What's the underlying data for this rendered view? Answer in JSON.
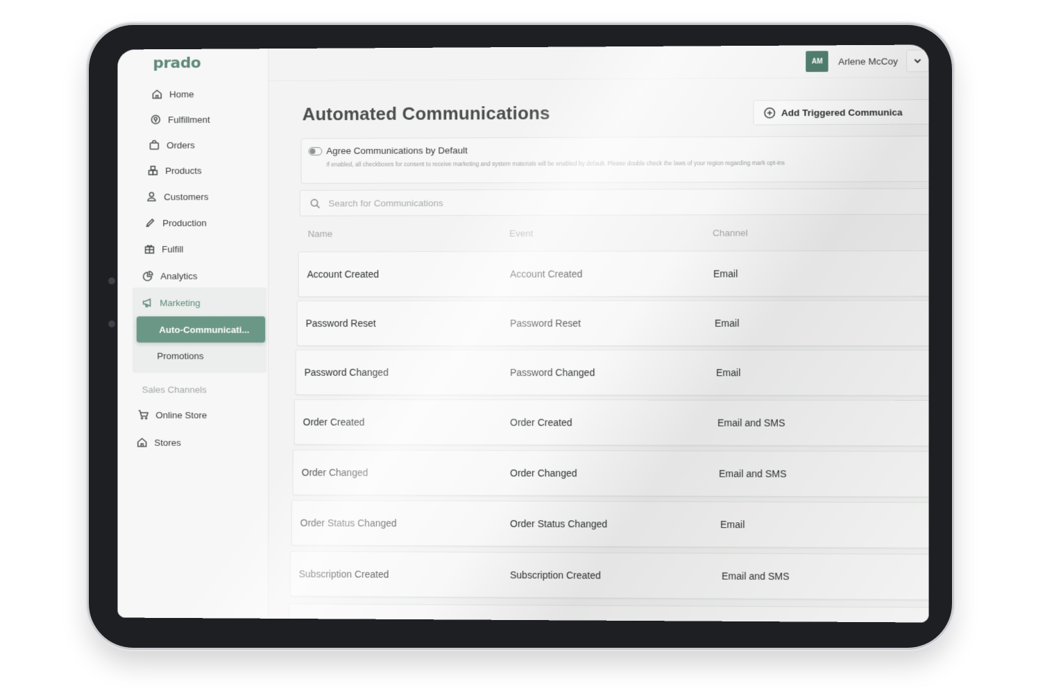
{
  "brand": {
    "logo": "prado",
    "accent": "#6b9787"
  },
  "sidebar": {
    "items": [
      {
        "label": "Home",
        "icon": "home-icon"
      },
      {
        "label": "Fulfillment",
        "icon": "location-pin-icon"
      },
      {
        "label": "Orders",
        "icon": "shopping-bag-icon"
      },
      {
        "label": "Products",
        "icon": "boxes-icon"
      },
      {
        "label": "Customers",
        "icon": "user-icon"
      },
      {
        "label": "Production",
        "icon": "pencil-icon"
      },
      {
        "label": "Fulfill",
        "icon": "gift-icon"
      },
      {
        "label": "Analytics",
        "icon": "pie-chart-icon"
      }
    ],
    "marketing": {
      "label": "Marketing",
      "icon": "megaphone-icon",
      "subitems": [
        {
          "label": "Auto-Communicati...",
          "active": true
        },
        {
          "label": "Promotions",
          "active": false
        }
      ]
    },
    "sales_channels": {
      "label": "Sales Channels",
      "items": [
        {
          "label": "Online Store",
          "icon": "cart-icon"
        },
        {
          "label": "Stores",
          "icon": "store-icon"
        }
      ]
    }
  },
  "header": {
    "user": {
      "initials": "AM",
      "name": "Arlene McCoy"
    }
  },
  "main": {
    "title": "Automated Communications",
    "add_button": "Add Triggered Communica",
    "agree": {
      "title": "Agree Communications by Default",
      "description": "If enabled, all checkboxes for consent to receive marketing and system materials will be enabled by default. Please double check the laws of your region regarding mark opt-ins",
      "enabled": false
    },
    "search_placeholder": "Search for Communications",
    "columns": [
      "Name",
      "Event",
      "Channel"
    ],
    "rows": [
      {
        "name": "Account Created",
        "event": "Account Created",
        "channel": "Email"
      },
      {
        "name": "Password Reset",
        "event": "Password Reset",
        "channel": "Email"
      },
      {
        "name": "Password Changed",
        "event": "Password Changed",
        "channel": "Email"
      },
      {
        "name": "Order Created",
        "event": "Order Created",
        "channel": "Email and SMS"
      },
      {
        "name": "Order Changed",
        "event": "Order Changed",
        "channel": "Email and SMS"
      },
      {
        "name": "Order Status Changed",
        "event": "Order Status Changed",
        "channel": "Email"
      },
      {
        "name": "Subscription Created",
        "event": "Subscription Created",
        "channel": "Email and SMS"
      }
    ]
  }
}
